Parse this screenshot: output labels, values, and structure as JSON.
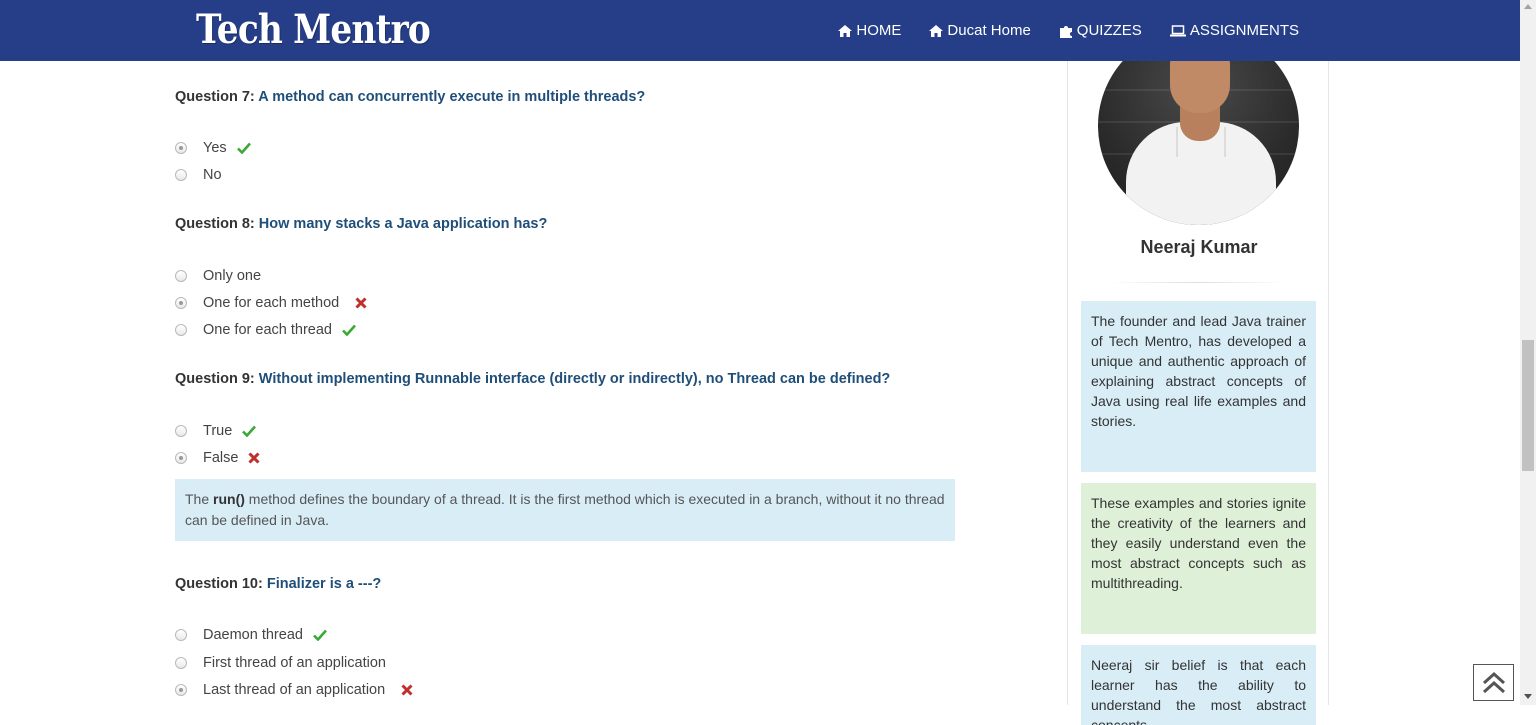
{
  "brand": {
    "logo_text": "Tech Mentro"
  },
  "nav": {
    "items": [
      {
        "label": "HOME",
        "icon": "home-icon"
      },
      {
        "label": "Ducat Home",
        "icon": "home-icon"
      },
      {
        "label": "QUIZZES",
        "icon": "puzzle-icon"
      },
      {
        "label": "ASSIGNMENTS",
        "icon": "laptop-icon"
      }
    ]
  },
  "questions": [
    {
      "label": "Question 7:",
      "text": "A method can concurrently execute in multiple threads?",
      "options": [
        {
          "text": "Yes",
          "selected": true,
          "result": "correct"
        },
        {
          "text": "No",
          "selected": false,
          "result": ""
        }
      ]
    },
    {
      "label": "Question 8:",
      "text": "How many stacks a Java application has?",
      "options": [
        {
          "text": "Only one",
          "selected": false,
          "result": ""
        },
        {
          "text": "One for each method",
          "selected": true,
          "result": "wrong"
        },
        {
          "text": "One for each thread",
          "selected": false,
          "result": "correct"
        }
      ]
    },
    {
      "label": "Question 9:",
      "text": "Without implementing Runnable interface (directly or indirectly), no Thread can be defined?",
      "options": [
        {
          "text": "True",
          "selected": false,
          "result": "correct"
        },
        {
          "text": "False",
          "selected": true,
          "result": "wrong"
        }
      ],
      "explanation": {
        "prefix": "The ",
        "bold": "run()",
        "suffix": " method defines the boundary of a thread. It is the first method which is executed in a branch, without it no thread can be defined in Java."
      }
    },
    {
      "label": "Question 10:",
      "text": "Finalizer is a ---?",
      "options": [
        {
          "text": "Daemon thread",
          "selected": false,
          "result": "correct"
        },
        {
          "text": "First thread of an application",
          "selected": false,
          "result": ""
        },
        {
          "text": "Last thread of an application",
          "selected": true,
          "result": "wrong"
        }
      ]
    }
  ],
  "sidebar": {
    "name": "Neeraj Kumar",
    "boxes": [
      {
        "color": "blue",
        "text": "The founder and lead Java trainer of Tech Mentro, has developed a unique and authentic approach of explaining abstract concepts of Java using real life examples and stories."
      },
      {
        "color": "green",
        "text": "These examples and stories ignite the creativity of the learners and they easily understand even the most abstract concepts such as multithreading."
      },
      {
        "color": "blue",
        "text": "Neeraj sir belief is that each learner has the ability to understand the most abstract concepts"
      }
    ]
  },
  "colors": {
    "navbar": "#263e87",
    "correct": "#3aa935",
    "wrong": "#c0302a",
    "info_blue": "#d9edf7",
    "info_green": "#dff0d8"
  }
}
